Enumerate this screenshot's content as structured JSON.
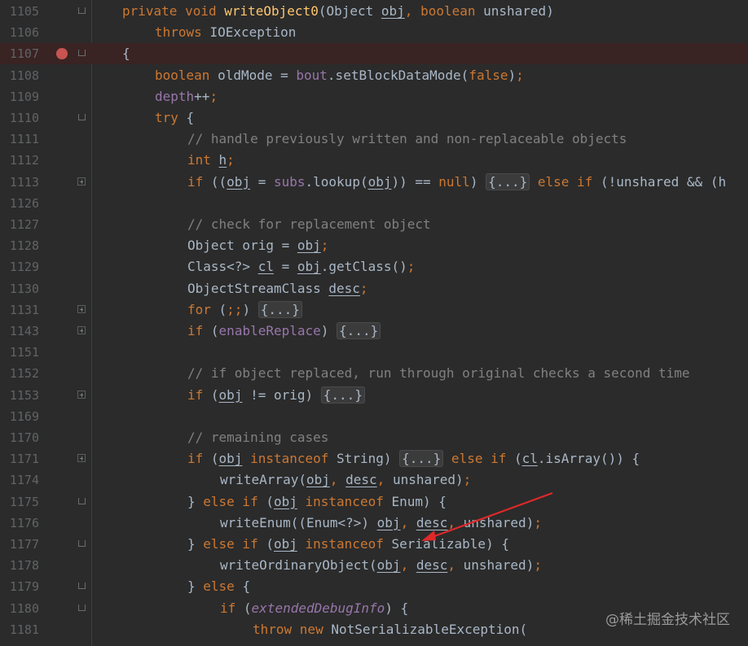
{
  "watermark": "@稀土掘金技术社区",
  "colors": {
    "background": "#2b2b2b",
    "keyword": "#cc7832",
    "method": "#ffc66d",
    "field": "#9876aa",
    "comment": "#808080",
    "breakpoint": "#c75450",
    "annotation_arrow": "#e0282a"
  },
  "lines": [
    {
      "n": "1105",
      "indent": 1,
      "fold": "arrow",
      "tokens": [
        [
          "kw",
          "private "
        ],
        [
          "kw",
          "void "
        ],
        [
          "fn",
          "writeObject0"
        ],
        [
          "",
          "(Object "
        ],
        [
          "ul",
          "obj"
        ],
        [
          "kw",
          ", "
        ],
        [
          "kw",
          "boolean "
        ],
        [
          "",
          "unshared)"
        ]
      ]
    },
    {
      "n": "1106",
      "indent": 2,
      "tokens": [
        [
          "kw",
          "throws "
        ],
        [
          "",
          "IOException"
        ]
      ]
    },
    {
      "n": "1107",
      "indent": 1,
      "breakpoint": true,
      "fold": "arrow",
      "tokens": [
        [
          "",
          "{"
        ]
      ]
    },
    {
      "n": "1108",
      "indent": 2,
      "tokens": [
        [
          "kw",
          "boolean "
        ],
        [
          "",
          "oldMode = "
        ],
        [
          "fld",
          "bout"
        ],
        [
          "",
          ".setBlockDataMode("
        ],
        [
          "kw",
          "false"
        ],
        [
          "",
          ")"
        ],
        [
          "kw",
          ";"
        ]
      ]
    },
    {
      "n": "1109",
      "indent": 2,
      "tokens": [
        [
          "fld",
          "depth"
        ],
        [
          "",
          "++"
        ],
        [
          "kw",
          ";"
        ]
      ]
    },
    {
      "n": "1110",
      "indent": 2,
      "fold": "arrow",
      "tokens": [
        [
          "kw",
          "try "
        ],
        [
          "",
          "{"
        ]
      ]
    },
    {
      "n": "1111",
      "indent": 3,
      "tokens": [
        [
          "cm",
          "// handle previously written and non-replaceable objects"
        ]
      ]
    },
    {
      "n": "1112",
      "indent": 3,
      "tokens": [
        [
          "kw",
          "int "
        ],
        [
          "ul",
          "h"
        ],
        [
          "kw",
          ";"
        ]
      ]
    },
    {
      "n": "1113",
      "indent": 3,
      "fold": "plus",
      "tokens": [
        [
          "kw",
          "if "
        ],
        [
          "",
          "(("
        ],
        [
          "ul",
          "obj"
        ],
        [
          "",
          " = "
        ],
        [
          "fld",
          "subs"
        ],
        [
          "",
          ".lookup("
        ],
        [
          "ul",
          "obj"
        ],
        [
          "",
          ")) == "
        ],
        [
          "kw",
          "null"
        ],
        [
          "",
          ") "
        ],
        [
          "fold",
          "{...}"
        ],
        [
          "",
          " "
        ],
        [
          "kw",
          "else if "
        ],
        [
          "",
          "(!unshared && (h"
        ]
      ]
    },
    {
      "n": "1126",
      "indent": 0,
      "tokens": []
    },
    {
      "n": "1127",
      "indent": 3,
      "tokens": [
        [
          "cm",
          "// check for replacement object"
        ]
      ]
    },
    {
      "n": "1128",
      "indent": 3,
      "tokens": [
        [
          "",
          "Object orig = "
        ],
        [
          "ul",
          "obj"
        ],
        [
          "kw",
          ";"
        ]
      ]
    },
    {
      "n": "1129",
      "indent": 3,
      "tokens": [
        [
          "",
          "Class<?> "
        ],
        [
          "ul",
          "cl"
        ],
        [
          "",
          " = "
        ],
        [
          "ul",
          "obj"
        ],
        [
          "",
          ".getClass()"
        ],
        [
          "kw",
          ";"
        ]
      ]
    },
    {
      "n": "1130",
      "indent": 3,
      "tokens": [
        [
          "",
          "ObjectStreamClass "
        ],
        [
          "ul",
          "desc"
        ],
        [
          "kw",
          ";"
        ]
      ]
    },
    {
      "n": "1131",
      "indent": 3,
      "fold": "plus",
      "tokens": [
        [
          "kw",
          "for "
        ],
        [
          "",
          "("
        ],
        [
          "kw",
          ";;"
        ],
        [
          "",
          ") "
        ],
        [
          "fold",
          "{...}"
        ]
      ]
    },
    {
      "n": "1143",
      "indent": 3,
      "fold": "plus",
      "tokens": [
        [
          "kw",
          "if "
        ],
        [
          "",
          "("
        ],
        [
          "fld",
          "enableReplace"
        ],
        [
          "",
          ") "
        ],
        [
          "fold",
          "{...}"
        ]
      ]
    },
    {
      "n": "1151",
      "indent": 0,
      "tokens": []
    },
    {
      "n": "1152",
      "indent": 3,
      "tokens": [
        [
          "cm",
          "// if object replaced, run through original checks a second time"
        ]
      ]
    },
    {
      "n": "1153",
      "indent": 3,
      "fold": "plus",
      "tokens": [
        [
          "kw",
          "if "
        ],
        [
          "",
          "("
        ],
        [
          "ul",
          "obj"
        ],
        [
          "",
          " != orig) "
        ],
        [
          "fold",
          "{...}"
        ]
      ]
    },
    {
      "n": "1169",
      "indent": 0,
      "tokens": []
    },
    {
      "n": "1170",
      "indent": 3,
      "tokens": [
        [
          "cm",
          "// remaining cases"
        ]
      ]
    },
    {
      "n": "1171",
      "indent": 3,
      "fold": "plus",
      "tokens": [
        [
          "kw",
          "if "
        ],
        [
          "",
          "("
        ],
        [
          "ul",
          "obj"
        ],
        [
          "kw",
          " instanceof "
        ],
        [
          "",
          "String) "
        ],
        [
          "fold",
          "{...}"
        ],
        [
          "",
          " "
        ],
        [
          "kw",
          "else if "
        ],
        [
          "",
          "("
        ],
        [
          "ul",
          "cl"
        ],
        [
          "",
          ".isArray()) {"
        ]
      ]
    },
    {
      "n": "1174",
      "indent": 4,
      "tokens": [
        [
          "",
          "writeArray("
        ],
        [
          "ul",
          "obj"
        ],
        [
          "kw",
          ", "
        ],
        [
          "ul",
          "desc"
        ],
        [
          "kw",
          ", "
        ],
        [
          "",
          "unshared)"
        ],
        [
          "kw",
          ";"
        ]
      ]
    },
    {
      "n": "1175",
      "indent": 3,
      "fold": "arrow",
      "tokens": [
        [
          "",
          "} "
        ],
        [
          "kw",
          "else if "
        ],
        [
          "",
          "("
        ],
        [
          "ul",
          "obj"
        ],
        [
          "kw",
          " instanceof "
        ],
        [
          "",
          "Enum) {"
        ]
      ]
    },
    {
      "n": "1176",
      "indent": 4,
      "tokens": [
        [
          "",
          "writeEnum((Enum<?>) "
        ],
        [
          "ul",
          "obj"
        ],
        [
          "kw",
          ", "
        ],
        [
          "ul",
          "desc"
        ],
        [
          "kw",
          ", "
        ],
        [
          "",
          "unshared)"
        ],
        [
          "kw",
          ";"
        ]
      ]
    },
    {
      "n": "1177",
      "indent": 3,
      "fold": "arrow",
      "tokens": [
        [
          "",
          "} "
        ],
        [
          "kw",
          "else if "
        ],
        [
          "",
          "("
        ],
        [
          "ul",
          "obj"
        ],
        [
          "kw",
          " instanceof "
        ],
        [
          "",
          "Serializable) {"
        ]
      ]
    },
    {
      "n": "1178",
      "indent": 4,
      "tokens": [
        [
          "",
          "writeOrdinaryObject("
        ],
        [
          "ul",
          "obj"
        ],
        [
          "kw",
          ", "
        ],
        [
          "ul",
          "desc"
        ],
        [
          "kw",
          ", "
        ],
        [
          "",
          "unshared)"
        ],
        [
          "kw",
          ";"
        ]
      ]
    },
    {
      "n": "1179",
      "indent": 3,
      "fold": "arrow",
      "tokens": [
        [
          "",
          "} "
        ],
        [
          "kw",
          "else "
        ],
        [
          "",
          "{"
        ]
      ]
    },
    {
      "n": "1180",
      "indent": 4,
      "fold": "arrow",
      "tokens": [
        [
          "kw",
          "if "
        ],
        [
          "",
          "("
        ],
        [
          "fld-it",
          "extendedDebugInfo"
        ],
        [
          "",
          ") {"
        ]
      ]
    },
    {
      "n": "1181",
      "indent": 5,
      "tokens": [
        [
          "kw",
          "throw new "
        ],
        [
          "",
          "NotSerializableException("
        ]
      ]
    }
  ]
}
